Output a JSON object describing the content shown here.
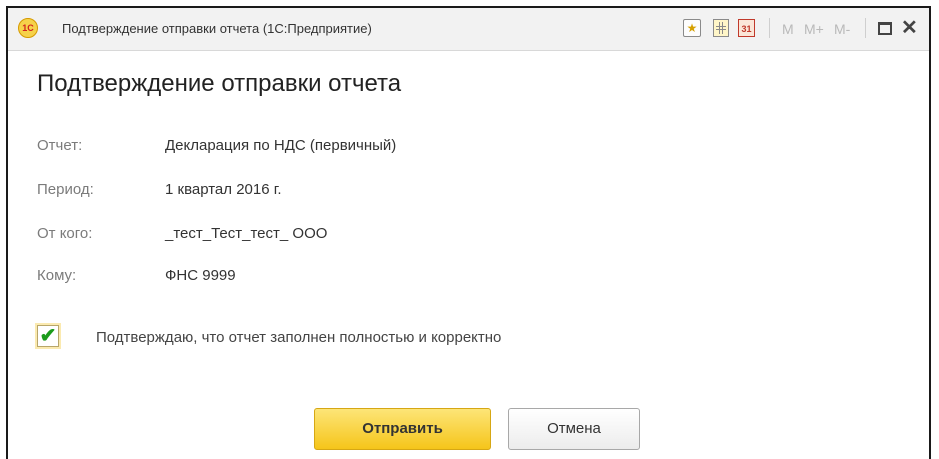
{
  "window": {
    "title": "Подтверждение отправки отчета  (1С:Предприятие)",
    "logo_text": "1С",
    "toolbar": {
      "favorite_icon": "star-icon",
      "calculator_icon": "calculator-icon",
      "calendar_icon": "calendar-icon",
      "calendar_text": "31",
      "memory_labels": [
        "M",
        "M+",
        "M-"
      ],
      "maximize_icon": "maximize-icon",
      "close_icon": "close-icon",
      "close_glyph": "✕"
    }
  },
  "dialog": {
    "heading": "Подтверждение отправки отчета",
    "fields": [
      {
        "label": "Отчет:",
        "value": "Декларация по НДС (первичный)"
      },
      {
        "label": "Период:",
        "value": "1 квартал 2016 г."
      },
      {
        "label": "От кого:",
        "value": "_тест_Тест_тест_ ООО"
      },
      {
        "label": "Кому:",
        "value": "ФНС 9999"
      }
    ],
    "confirm": {
      "checked": true,
      "checkmark": "✔",
      "text": "Подтверждаю, что отчет заполнен полностью и корректно"
    },
    "buttons": {
      "send": "Отправить",
      "cancel": "Отмена"
    }
  },
  "colors": {
    "primary_button": "#f5c51a",
    "check_green": "#1b9b1b",
    "label_gray": "#7b7b7b"
  }
}
